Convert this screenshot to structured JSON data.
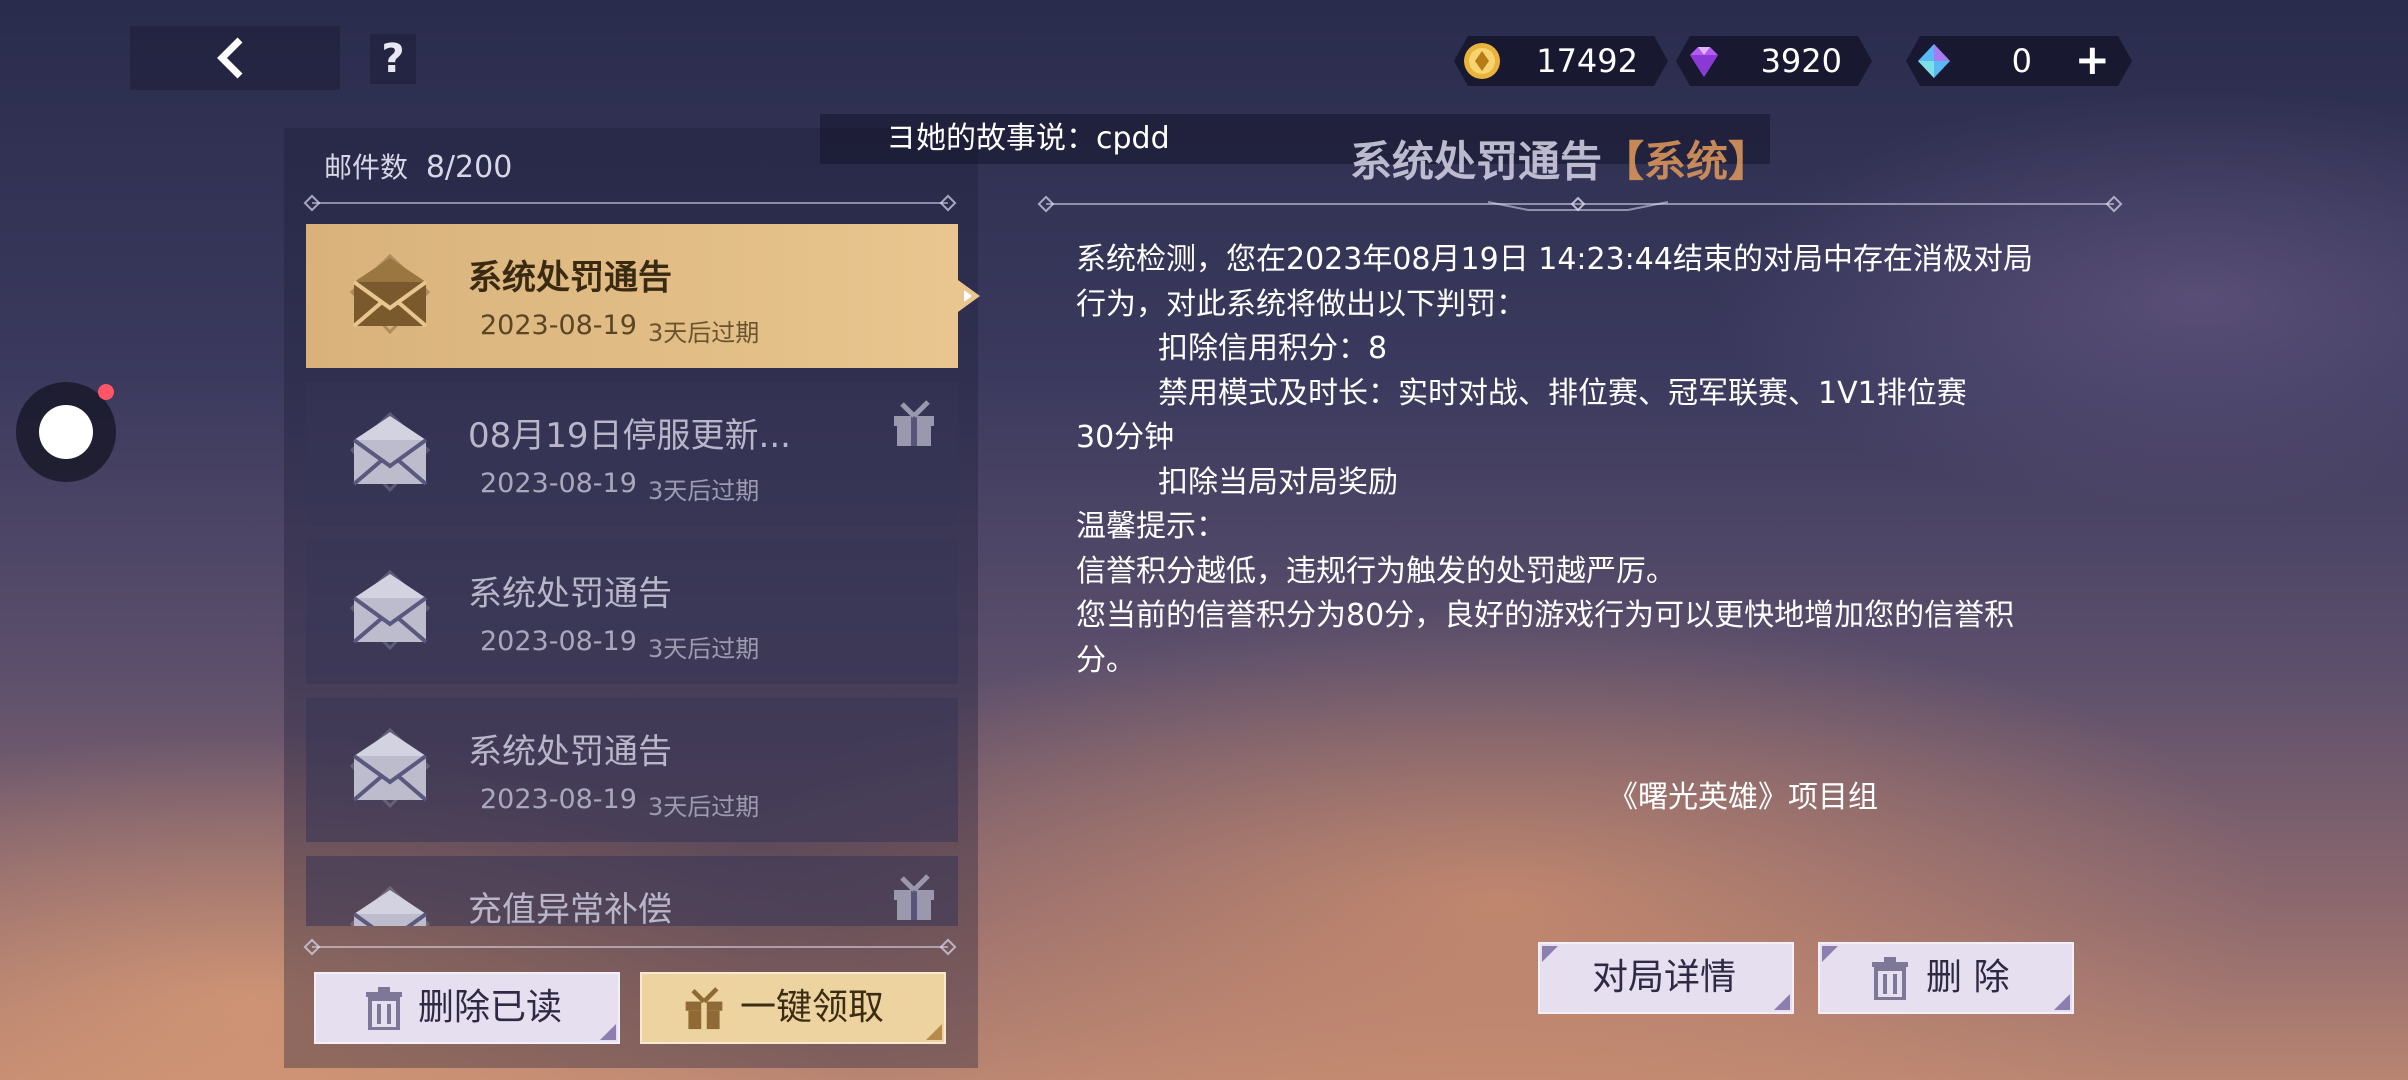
{
  "top_bar": {
    "help_label": "?",
    "currencies": [
      {
        "icon": "gold-coin-icon",
        "value": "17492"
      },
      {
        "icon": "purple-diamond-icon",
        "value": "3920"
      },
      {
        "icon": "blue-crystal-icon",
        "value": "0"
      }
    ],
    "plus_label": "+"
  },
  "ticker": {
    "text": "ヨ她的故事说：cpdd"
  },
  "mail_panel": {
    "count_label": "邮件数",
    "count_value": "8/200",
    "items": [
      {
        "title": "系统处罚通告",
        "date": "2023-08-19",
        "expire": "3天后过期",
        "has_gift": false,
        "selected": true
      },
      {
        "title": "08月19日停服更新...",
        "date": "2023-08-19",
        "expire": "3天后过期",
        "has_gift": true,
        "selected": false
      },
      {
        "title": "系统处罚通告",
        "date": "2023-08-19",
        "expire": "3天后过期",
        "has_gift": false,
        "selected": false
      },
      {
        "title": "系统处罚通告",
        "date": "2023-08-19",
        "expire": "3天后过期",
        "has_gift": false,
        "selected": false
      },
      {
        "title": "充值异常补偿",
        "date": "",
        "expire": "",
        "has_gift": true,
        "selected": false
      }
    ],
    "delete_read_label": "删除已读",
    "claim_all_label": "一键领取"
  },
  "detail": {
    "title": "系统处罚通告",
    "tag": "【系统】",
    "lines": [
      "系统检测，您在2023年08月19日 14:23:44结束的对局中存在消极对局",
      "行为，对此系统将做出以下判罚：",
      "扣除信用积分：8",
      "禁用模式及时长：实时对战、排位赛、冠军联赛、1V1排位赛",
      "30分钟",
      "扣除当局对局奖励",
      "温馨提示：",
      "信誉积分越低，违规行为触发的处罚越严厉。",
      "您当前的信誉积分为80分，良好的游戏行为可以更快地增加您的信誉积",
      "分。"
    ],
    "signature": "《曙光英雄》项目组",
    "match_details_label": "对局详情",
    "delete_label": "删 除"
  },
  "colors": {
    "selected_item": "#e0bb82",
    "tag_orange": "#e39a5c",
    "button_light": "#e6dff0",
    "button_gold": "#ecd3a0",
    "notification_dot": "#ff5566"
  }
}
